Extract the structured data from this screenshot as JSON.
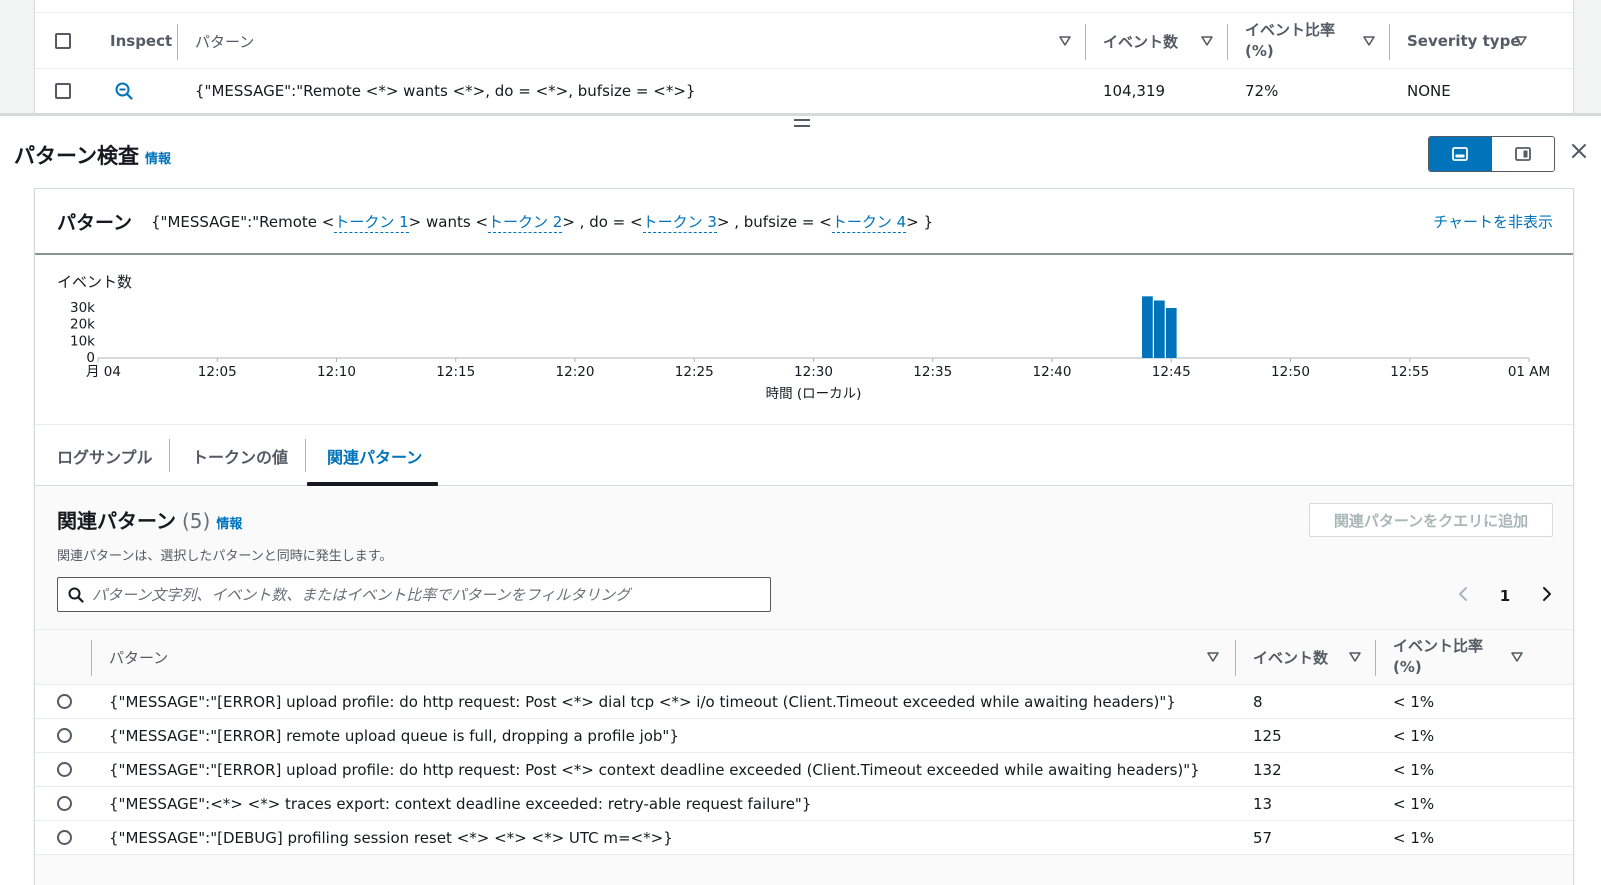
{
  "top_table": {
    "headers": {
      "inspect": "Inspect",
      "pattern": "パターン",
      "event_count": "イベント数",
      "event_ratio_1": "イベント比率",
      "event_ratio_2": "(%)",
      "severity": "Severity type"
    },
    "row": {
      "pattern": "{\"MESSAGE\":\"Remote <*> wants <*>, do = <*>, bufsize = <*>}",
      "event_count": "104,319",
      "event_ratio": "72%",
      "severity": "NONE"
    }
  },
  "panel": {
    "title": "パターン検査",
    "info": "情報",
    "pattern_label": "パターン",
    "pattern_parts": {
      "p0": "{\"MESSAGE\":\"Remote <",
      "t1": "トークン 1",
      "p1": "> wants <",
      "t2": "トークン 2",
      "p2": "> , do = <",
      "t3": "トークン 3",
      "p3": "> , bufsize = <",
      "t4": "トークン 4",
      "p4": "> }"
    },
    "hide_chart": "チャートを非表示"
  },
  "chart_data": {
    "type": "bar",
    "ylabel": "イベント数",
    "xlabel": "時間 (ローカル)",
    "y_ticks": [
      "30k",
      "20k",
      "10k",
      "0"
    ],
    "y_tick_values": [
      30000,
      20000,
      10000,
      0
    ],
    "ylim": [
      0,
      30000
    ],
    "x_tick_labels": [
      "月 04",
      "12:05",
      "12:10",
      "12:15",
      "12:20",
      "12:25",
      "12:30",
      "12:35",
      "12:40",
      "12:45",
      "12:50",
      "12:55",
      "01 AM"
    ],
    "x_tick_minutes": [
      0,
      5,
      10,
      15,
      20,
      25,
      30,
      35,
      40,
      45,
      50,
      55,
      60
    ],
    "xlim": [
      0,
      60
    ],
    "bars": [
      {
        "x": 44.0,
        "value": 37000
      },
      {
        "x": 44.5,
        "value": 34500
      },
      {
        "x": 45.0,
        "value": 30000
      }
    ],
    "bar_width_minutes": 0.45,
    "color": "#0073bb"
  },
  "tabs": [
    {
      "label": "ログサンプル"
    },
    {
      "label": "トークンの値"
    },
    {
      "label": "関連パターン"
    }
  ],
  "related": {
    "title": "関連パターン",
    "count": "(5)",
    "info": "情報",
    "description": "関連パターンは、選択したパターンと同時に発生します。",
    "add_button": "関連パターンをクエリに追加",
    "search_placeholder": "パターン文字列、イベント数、またはイベント比率でパターンをフィルタリング",
    "page": "1",
    "headers": {
      "pattern": "パターン",
      "event_count": "イベント数",
      "event_ratio_1": "イベント比率",
      "event_ratio_2": "(%)"
    },
    "rows": [
      {
        "pattern": "{\"MESSAGE\":\"[ERROR] upload profile: do http request: Post <*> dial tcp <*> i/o timeout (Client.Timeout exceeded while awaiting headers)\"}",
        "count": "8",
        "ratio": "< 1%"
      },
      {
        "pattern": "{\"MESSAGE\":\"[ERROR] remote upload queue is full, dropping a profile job\"}",
        "count": "125",
        "ratio": "< 1%"
      },
      {
        "pattern": "{\"MESSAGE\":\"[ERROR] upload profile: do http request: Post <*> context deadline exceeded (Client.Timeout exceeded while awaiting headers)\"}",
        "count": "132",
        "ratio": "< 1%"
      },
      {
        "pattern": "{\"MESSAGE\":<*> <*> traces export: context deadline exceeded: retry-able request failure\"}",
        "count": "13",
        "ratio": "< 1%"
      },
      {
        "pattern": "{\"MESSAGE\":\"[DEBUG] profiling session reset <*> <*> <*> UTC m=<*>}",
        "count": "57",
        "ratio": "< 1%"
      }
    ]
  },
  "colors": {
    "accent": "#0073bb",
    "text": "#16191f",
    "muted": "#545b64",
    "border": "#d5dbdb"
  }
}
